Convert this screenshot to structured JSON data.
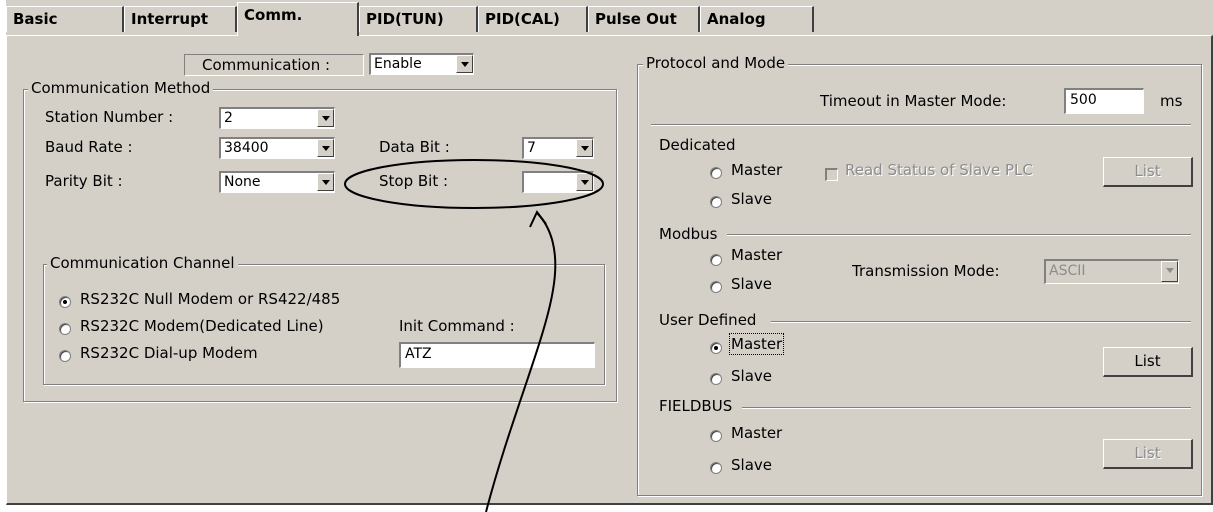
{
  "tabs": [
    {
      "label": "Basic"
    },
    {
      "label": "Interrupt"
    },
    {
      "label": "Comm."
    },
    {
      "label": "PID(TUN)"
    },
    {
      "label": "PID(CAL)"
    },
    {
      "label": "Pulse Out"
    },
    {
      "label": "Analog"
    }
  ],
  "active_tab": "Comm.",
  "communication": {
    "label": "Communication :",
    "value": "Enable"
  },
  "method": {
    "legend": "Communication Method",
    "station_label": "Station Number :",
    "station_value": "2",
    "baud_label": "Baud Rate :",
    "baud_value": "38400",
    "data_bit_label": "Data Bit :",
    "data_bit_value": "7",
    "parity_label": "Parity Bit :",
    "parity_value": "None",
    "stop_bit_label": "Stop Bit :",
    "stop_bit_value": ""
  },
  "channel": {
    "legend": "Communication Channel",
    "options": [
      {
        "label": "RS232C Null Modem or RS422/485",
        "selected": true
      },
      {
        "label": "RS232C Modem(Dedicated Line)",
        "selected": false
      },
      {
        "label": "RS232C Dial-up Modem",
        "selected": false
      }
    ],
    "init_label": "Init Command :",
    "init_value": "ATZ"
  },
  "protocol": {
    "legend": "Protocol and Mode",
    "timeout_label": "Timeout in Master Mode:",
    "timeout_value": "500",
    "timeout_unit": "ms",
    "dedicated": {
      "label": "Dedicated",
      "master": "Master",
      "slave": "Slave",
      "read_status": "Read Status of Slave PLC",
      "list": "List"
    },
    "modbus": {
      "label": "Modbus",
      "master": "Master",
      "slave": "Slave",
      "trans_label": "Transmission Mode:",
      "trans_value": "ASCII"
    },
    "user_defined": {
      "label": "User Defined",
      "master": "Master",
      "slave": "Slave",
      "list": "List"
    },
    "fieldbus": {
      "label": "FIELDBUS",
      "master": "Master",
      "slave": "Slave",
      "list": "List"
    }
  },
  "colors": {
    "face": "#d4d0c8",
    "shadow": "#808080",
    "disabled_text": "#8c8c8c"
  }
}
